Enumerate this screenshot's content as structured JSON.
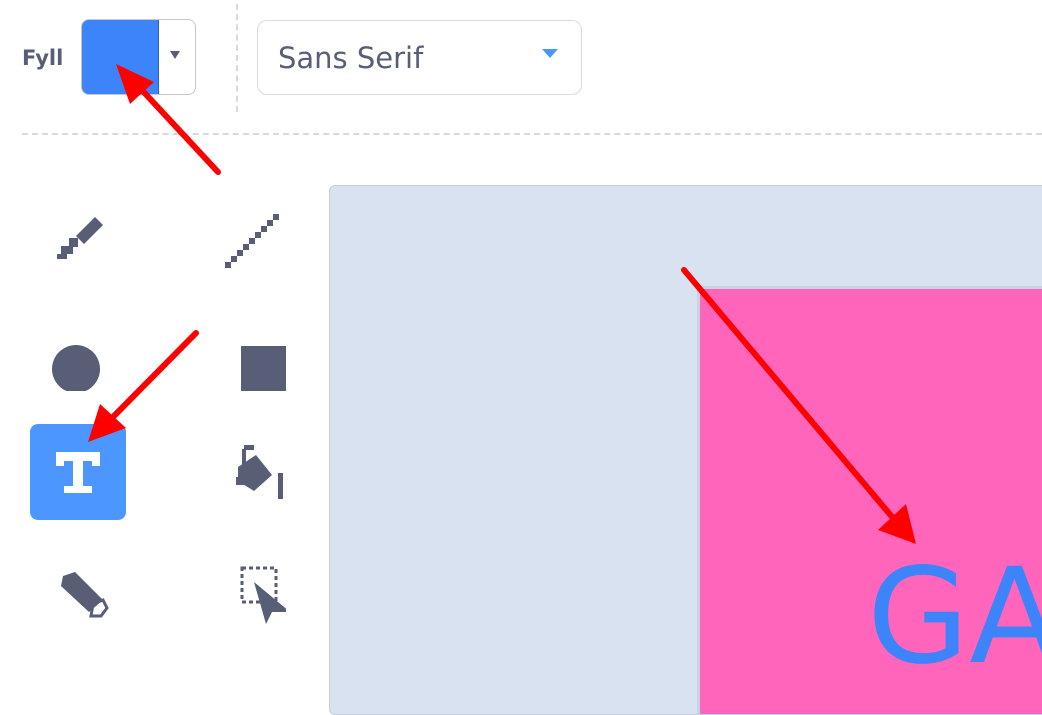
{
  "toolbar": {
    "fill_label": "Fyll",
    "fill_color": "#3d83fa",
    "font_select_value": "Sans Serif"
  },
  "tools": [
    {
      "name": "brush",
      "icon": "brush-icon",
      "selected": false
    },
    {
      "name": "line",
      "icon": "line-icon",
      "selected": false
    },
    {
      "name": "circle",
      "icon": "circle-icon",
      "selected": false
    },
    {
      "name": "rectangle",
      "icon": "rectangle-icon",
      "selected": false
    },
    {
      "name": "text",
      "icon": "text-icon",
      "selected": true
    },
    {
      "name": "fill",
      "icon": "paint-bucket-icon",
      "selected": false
    },
    {
      "name": "eraser",
      "icon": "eraser-icon",
      "selected": false
    },
    {
      "name": "select",
      "icon": "select-icon",
      "selected": false
    }
  ],
  "canvas": {
    "background_color": "#ff66bb",
    "text": "GA",
    "text_color": "#3d83fa"
  },
  "colors": {
    "accent": "#4c97ff",
    "annotation_arrow": "#ff0000",
    "icon_gray": "#575e75"
  }
}
